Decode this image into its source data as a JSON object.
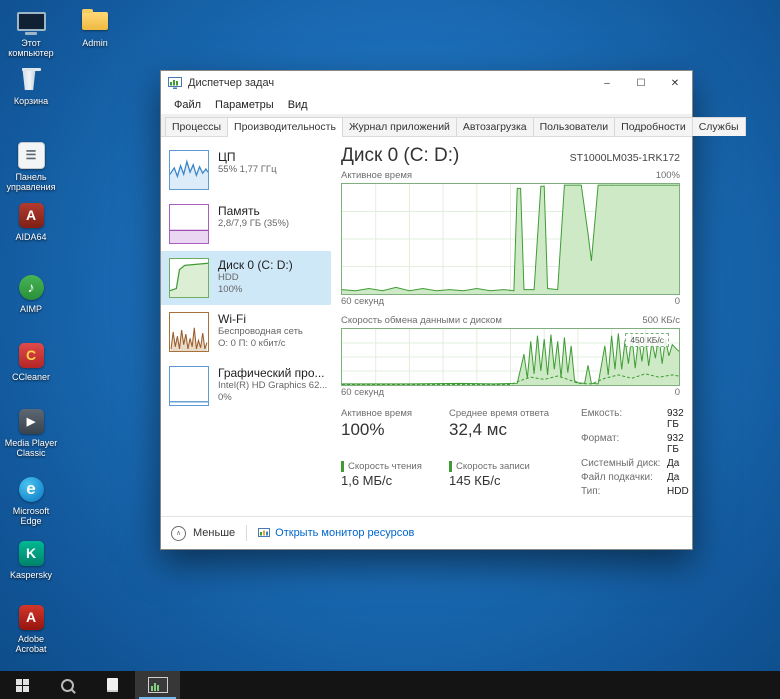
{
  "desktop": {
    "icons": [
      {
        "label": "Этот компьютер"
      },
      {
        "label": "Admin"
      },
      {
        "label": "Корзина"
      },
      {
        "label": "Панель управления"
      },
      {
        "label": "AIDA64"
      },
      {
        "label": "AIMP"
      },
      {
        "label": "CCleaner"
      },
      {
        "label": "Media Player Classic"
      },
      {
        "label": "Microsoft Edge"
      },
      {
        "label": "Kaspersky"
      },
      {
        "label": "Adobe Acrobat"
      }
    ]
  },
  "window": {
    "title": "Диспетчер задач",
    "controls": {
      "minimize": "–",
      "maximize": "☐",
      "close": "✕"
    },
    "menu": [
      "Файл",
      "Параметры",
      "Вид"
    ],
    "tabs": [
      "Процессы",
      "Производительность",
      "Журнал приложений",
      "Автозагрузка",
      "Пользователи",
      "Подробности",
      "Службы"
    ],
    "active_tab": "Производительность",
    "sidebar": [
      {
        "title": "ЦП",
        "line2": "55% 1,77 ГГц"
      },
      {
        "title": "Память",
        "line2": "2,8/7,9 ГБ (35%)"
      },
      {
        "title": "Диск 0 (C: D:)",
        "line2": "HDD",
        "line3": "100%"
      },
      {
        "title": "Wi-Fi",
        "line2": "Беспроводная сеть",
        "line3": "О: 0 П: 0 кбит/с"
      },
      {
        "title": "Графический про...",
        "line2": "Intel(R) HD Graphics 62...",
        "line3": "0%"
      }
    ],
    "main": {
      "title": "Диск 0 (C: D:)",
      "model": "ST1000LM035-1RK172",
      "stats": [
        {
          "label": "Активное время",
          "value": "100%"
        },
        {
          "label": "Среднее время ответа",
          "value": "32,4 мс"
        },
        {
          "label": "Скорость чтения",
          "value": "1,6 МБ/с"
        },
        {
          "label": "Скорость записи",
          "value": "145 КБ/с"
        }
      ],
      "details": [
        {
          "label": "Емкость:",
          "value": "932 ГБ"
        },
        {
          "label": "Формат:",
          "value": "932 ГБ"
        },
        {
          "label": "Системный диск:",
          "value": "Да"
        },
        {
          "label": "Файл подкачки:",
          "value": "Да"
        },
        {
          "label": "Тип:",
          "value": "HDD"
        }
      ]
    },
    "footer": {
      "less_label": "Меньше",
      "link_label": "Открыть монитор ресурсов"
    }
  },
  "chart_data": [
    {
      "type": "area",
      "title": "Активное время",
      "ylabel_max": "100%",
      "xlabel_left": "60 секунд",
      "xlabel_right": "0",
      "ylim": [
        0,
        100
      ],
      "unit": "%",
      "points": [
        [
          0,
          4
        ],
        [
          4,
          3
        ],
        [
          8,
          5
        ],
        [
          12,
          3
        ],
        [
          16,
          6
        ],
        [
          20,
          3
        ],
        [
          24,
          5
        ],
        [
          28,
          3
        ],
        [
          32,
          4
        ],
        [
          36,
          3
        ],
        [
          40,
          5
        ],
        [
          44,
          3
        ],
        [
          48,
          4
        ],
        [
          51,
          3
        ],
        [
          52,
          96
        ],
        [
          53,
          96
        ],
        [
          54,
          4
        ],
        [
          57,
          4
        ],
        [
          59,
          98
        ],
        [
          60,
          98
        ],
        [
          61,
          5
        ],
        [
          64,
          4
        ],
        [
          66,
          99
        ],
        [
          71,
          99
        ],
        [
          73,
          55
        ],
        [
          74,
          30
        ],
        [
          76,
          99
        ],
        [
          100,
          99
        ]
      ]
    },
    {
      "type": "area",
      "title": "Скорость обмена данными с диском",
      "ylabel_max": "500 КБ/с",
      "scale_label": "450 КБ/с",
      "xlabel_left": "60 секунд",
      "xlabel_right": "0",
      "ylim": [
        0,
        500
      ],
      "unit": "КБ/с",
      "read_points": [
        [
          0,
          2
        ],
        [
          20,
          2
        ],
        [
          35,
          3
        ],
        [
          45,
          2
        ],
        [
          52,
          3
        ],
        [
          54,
          55
        ],
        [
          55,
          12
        ],
        [
          56,
          78
        ],
        [
          57,
          20
        ],
        [
          58,
          88
        ],
        [
          59,
          25
        ],
        [
          60,
          82
        ],
        [
          61,
          18
        ],
        [
          62,
          90
        ],
        [
          63,
          28
        ],
        [
          64,
          78
        ],
        [
          65,
          14
        ],
        [
          66,
          85
        ],
        [
          67,
          22
        ],
        [
          68,
          70
        ],
        [
          69,
          8
        ],
        [
          70,
          4
        ],
        [
          72,
          3
        ],
        [
          73,
          35
        ],
        [
          74,
          3
        ],
        [
          76,
          2
        ],
        [
          78,
          70
        ],
        [
          79,
          18
        ],
        [
          80,
          88
        ],
        [
          81,
          28
        ],
        [
          82,
          92
        ],
        [
          83,
          28
        ],
        [
          84,
          80
        ],
        [
          85,
          38
        ],
        [
          86,
          90
        ],
        [
          87,
          30
        ],
        [
          88,
          84
        ],
        [
          89,
          42
        ],
        [
          90,
          88
        ],
        [
          91,
          34
        ],
        [
          92,
          78
        ],
        [
          93,
          48
        ],
        [
          94,
          90
        ],
        [
          95,
          38
        ],
        [
          96,
          82
        ],
        [
          97,
          52
        ],
        [
          98,
          72
        ],
        [
          100,
          60
        ]
      ],
      "write_points": [
        [
          0,
          1
        ],
        [
          50,
          1
        ],
        [
          53,
          8
        ],
        [
          56,
          14
        ],
        [
          60,
          10
        ],
        [
          64,
          16
        ],
        [
          68,
          8
        ],
        [
          70,
          3
        ],
        [
          74,
          2
        ],
        [
          78,
          12
        ],
        [
          82,
          18
        ],
        [
          86,
          12
        ],
        [
          90,
          20
        ],
        [
          94,
          14
        ],
        [
          98,
          18
        ],
        [
          100,
          16
        ]
      ]
    }
  ],
  "colors": {
    "wallpaper": "#1c6fba",
    "selection": "#cfe8f8",
    "link": "#0066cc",
    "chart_line": "#3f9c35",
    "chart_fill": "#cde9c5",
    "chart_grid": "#e2efdd",
    "chart_frame": "#7fae7f"
  }
}
